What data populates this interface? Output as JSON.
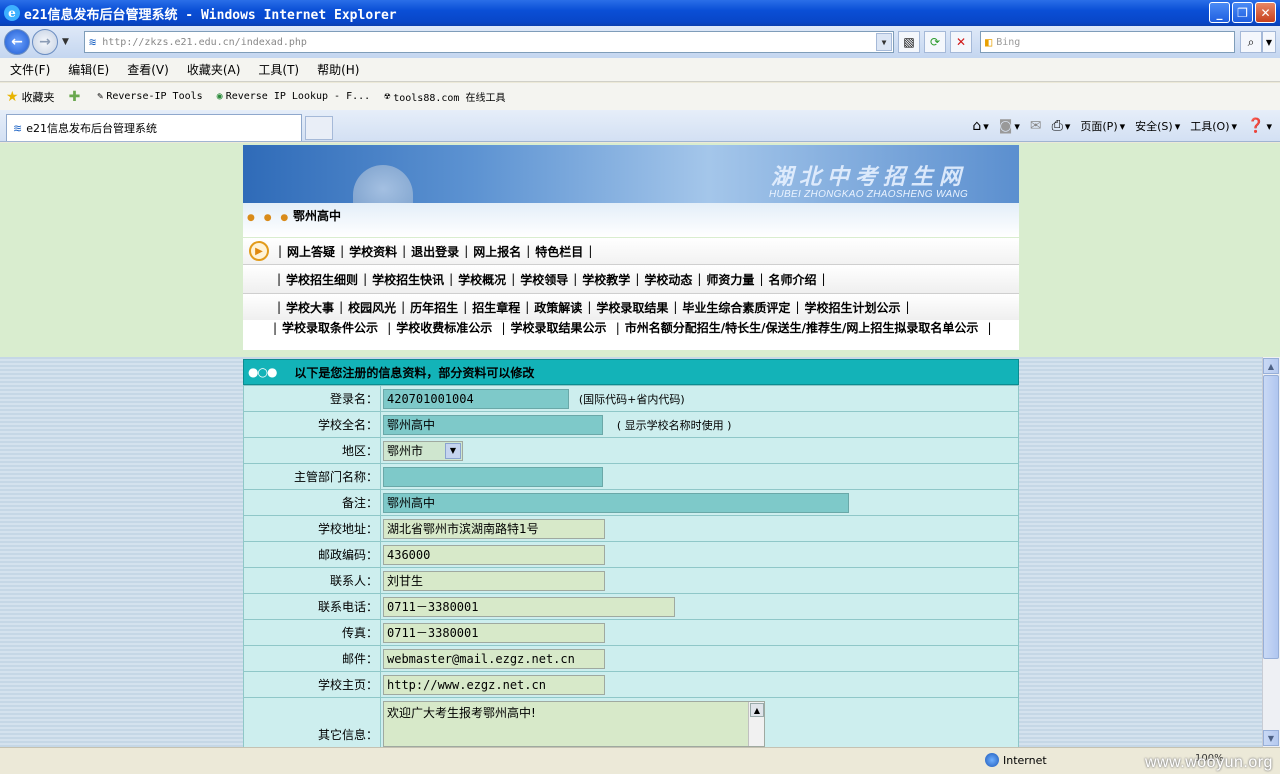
{
  "window": {
    "title": "e21信息发布后台管理系统 - Windows Internet Explorer"
  },
  "address_bar": {
    "url": "http://zkzs.e21.edu.cn/indexad.php",
    "search_placeholder": "Bing"
  },
  "menu": {
    "items": [
      "文件(F)",
      "编辑(E)",
      "查看(V)",
      "收藏夹(A)",
      "工具(T)",
      "帮助(H)"
    ]
  },
  "favorites": {
    "label": "收藏夹",
    "items": [
      "Reverse-IP Tools",
      "Reverse IP Lookup - F...",
      "tools88.com 在线工具"
    ]
  },
  "tab": {
    "title": "e21信息发布后台管理系统"
  },
  "commandbar": {
    "page_label": "页面(P)",
    "safety_label": "安全(S)",
    "tools_label": "工具(O)"
  },
  "banner": {
    "title": "湖北中考招生网",
    "subtitle": "HUBEI ZHONGKAO ZHAOSHENG WANG",
    "school": "鄂州高中"
  },
  "nav": {
    "row1": [
      "网上答疑",
      "学校资料",
      "退出登录",
      "网上报名",
      "特色栏目"
    ],
    "row2": [
      "学校招生细则",
      "学校招生快讯",
      "学校概况",
      "学校领导",
      "学校教学",
      "学校动态",
      "师资力量",
      "名师介绍"
    ],
    "row3": [
      "学校大事",
      "校园风光",
      "历年招生",
      "招生章程",
      "政策解读",
      "学校录取结果",
      "毕业生综合素质评定",
      "学校招生计划公示"
    ],
    "row4": [
      "学校录取条件公示",
      "学校收费标准公示",
      "学校录取结果公示",
      "市州名额分配招生/特长生/保送生/推荐生/网上招生拟录取名单公示"
    ]
  },
  "form": {
    "header": "以下是您注册的信息资料，部分资料可以修改",
    "login_label": "登录名：",
    "login_value": "420701001004",
    "login_hint": "(国际代码+省内代码)",
    "fullname_label": "学校全名：",
    "fullname_value": "鄂州高中",
    "fullname_hint": "( 显示学校名称时使用 )",
    "region_label": "地区：",
    "region_value": "鄂州市",
    "dept_label": "主管部门名称：",
    "dept_value": "",
    "note_label": "备注：",
    "note_value": "鄂州高中",
    "address_label": "学校地址：",
    "address_value": "湖北省鄂州市滨湖南路特1号",
    "postcode_label": "邮政编码：",
    "postcode_value": "436000",
    "contact_label": "联系人：",
    "contact_value": "刘甘生",
    "phone_label": "联系电话：",
    "phone_value": "0711－3380001",
    "fax_label": "传真：",
    "fax_value": "0711－3380001",
    "email_label": "邮件：",
    "email_value": "webmaster@mail.ezgz.net.cn",
    "homepage_label": "学校主页：",
    "homepage_value": "http://www.ezgz.net.cn",
    "other_label": "其它信息：",
    "other_value": "欢迎广大考生报考鄂州高中!"
  },
  "statusbar": {
    "zone": "Internet",
    "zoom": "100%"
  },
  "watermark": "www.wooyun.org"
}
